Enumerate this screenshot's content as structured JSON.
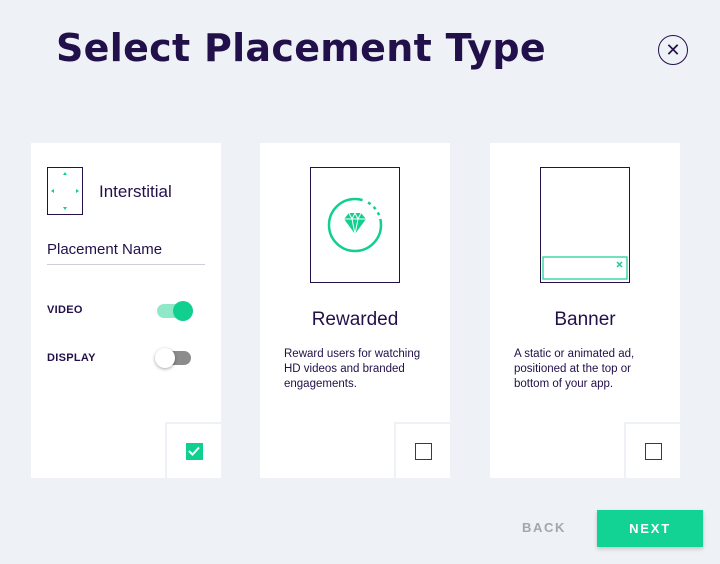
{
  "header": {
    "title": "Select Placement Type",
    "close_icon": "close-icon"
  },
  "cards": [
    {
      "type_label": "Interstitial",
      "placement_name": "Placement Name",
      "toggles": [
        {
          "label": "VIDEO",
          "on": true
        },
        {
          "label": "DISPLAY",
          "on": false
        }
      ],
      "selected": true
    },
    {
      "name": "Rewarded",
      "description": "Reward users for watching HD videos and branded engagements.",
      "icon": "diamond-icon",
      "selected": false
    },
    {
      "name": "Banner",
      "description": "A static or animated ad, positioned at the top or bottom of your app.",
      "icon": "banner-icon",
      "selected": false
    }
  ],
  "footer": {
    "back_label": "BACK",
    "next_label": "NEXT"
  },
  "colors": {
    "accent": "#10cf8f",
    "text": "#22104a",
    "background": "#eef1f5"
  }
}
